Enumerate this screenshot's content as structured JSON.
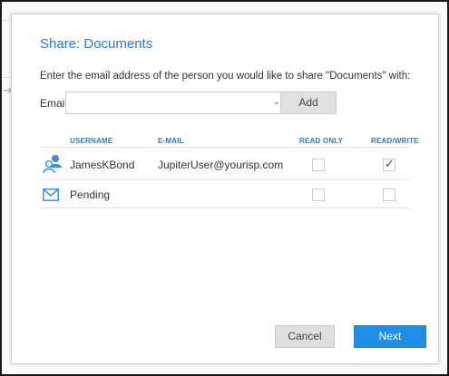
{
  "dialog": {
    "title": "Share: Documents",
    "prompt": "Enter the email address of the person you would like to share \"Documents\" with:",
    "email_label": "Email:",
    "email_value": "",
    "add_label": "Add"
  },
  "table": {
    "headers": [
      "USERNAME",
      "E-MAIL",
      "READ ONLY",
      "READ/WRITE"
    ],
    "rows": [
      {
        "icon": "users-icon",
        "username": "JamesKBond",
        "email": "JupiterUser@yourisp.com",
        "read_only": false,
        "read_write": true
      },
      {
        "icon": "mail-icon",
        "username": "Pending",
        "email": "",
        "read_only": false,
        "read_write": false
      }
    ]
  },
  "buttons": {
    "cancel": "Cancel",
    "next": "Next"
  },
  "colors": {
    "accent": "#2c7ac4",
    "primary_button": "#1f8fe6"
  }
}
